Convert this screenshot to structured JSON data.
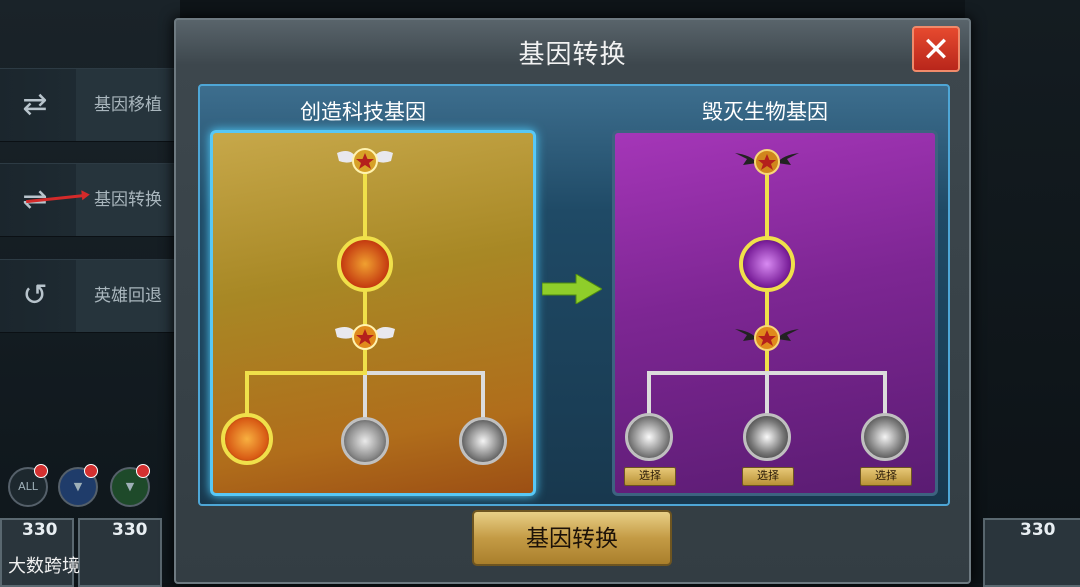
{
  "dialog": {
    "title": "基因转换",
    "close_symbol": "✕",
    "left_title": "创造科技基因",
    "right_title": "毁灭生物基因",
    "select_label": "选择",
    "convert_button": "基因转换"
  },
  "sidebar": {
    "items": [
      {
        "label": "基因移植",
        "icon": "dna-forward-icon"
      },
      {
        "label": "基因转换",
        "icon": "dna-convert-icon"
      },
      {
        "label": "英雄回退",
        "icon": "dna-undo-icon"
      }
    ]
  },
  "filters": [
    {
      "label": "ALL"
    },
    {
      "label": "▼"
    },
    {
      "label": "▼"
    }
  ],
  "levels": {
    "left1": "330",
    "left2": "330",
    "right1": "330"
  },
  "watermark": "大数跨境",
  "colors": {
    "gold_line": "#f0e04a",
    "white_line": "#dcdcdc",
    "accent_blue": "#4ea6d6",
    "close_red": "#d5321f"
  }
}
